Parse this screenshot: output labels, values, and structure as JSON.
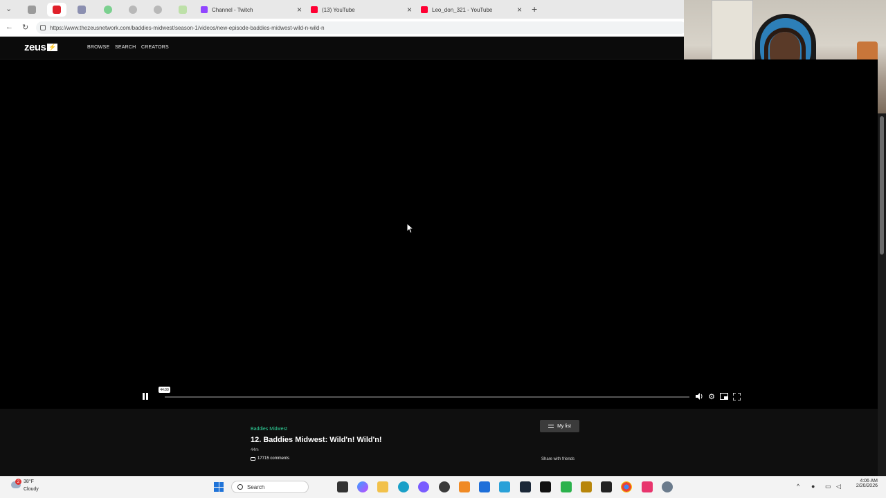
{
  "browser": {
    "tabs": [
      {
        "label": "Channel - Twitch",
        "color": "#9146ff"
      },
      {
        "label": "(13) YouTube",
        "color": "#ff0033"
      },
      {
        "label": "Leo_don_321 - YouTube",
        "color": "#ff0033"
      }
    ],
    "url": "https://www.thezeusnetwork.com/baddies-midwest/season-1/videos/new-episode-baddies-midwest-wild-n-wild-n"
  },
  "site": {
    "logo": "zeus",
    "nav": [
      "BROWSE",
      "SEARCH",
      "CREATORS"
    ]
  },
  "player": {
    "time_tooltip": "44:00",
    "state": "playing",
    "progress_fraction": 0.0
  },
  "episode": {
    "show": "Baddies Midwest",
    "title": "12. Baddies Midwest: Wild'n! Wild'n!",
    "duration": "44m",
    "comments": "17715 comments",
    "mylist_label": "My list",
    "share_label": "Share with friends"
  },
  "taskbar": {
    "badge": "2",
    "temperature": "38°F",
    "condition": "Cloudy",
    "search_label": "Search",
    "time": "4:06 AM",
    "date": "2/20/2026"
  },
  "colors": {
    "accent": "#2fd39b",
    "twitch": "#9146ff",
    "youtube": "#ff0033"
  }
}
